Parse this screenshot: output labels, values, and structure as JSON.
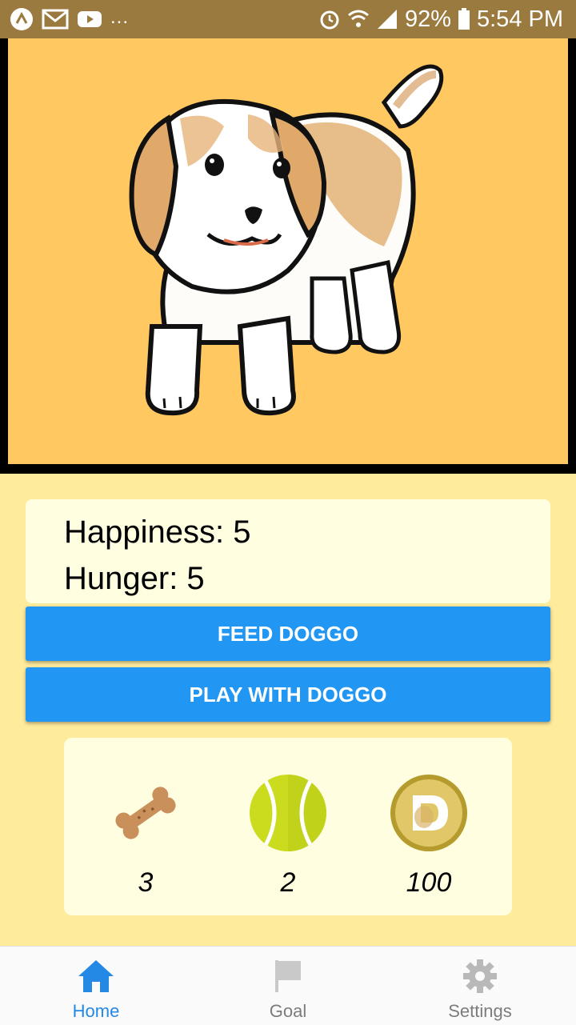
{
  "status_bar": {
    "overflow": "...",
    "battery": "92%",
    "time": "5:54 PM",
    "icons": [
      "app-icon",
      "gmail-icon",
      "youtube-icon",
      "alarm-icon",
      "wifi-icon",
      "signal-icon",
      "battery-icon"
    ]
  },
  "pet": {
    "image": "puppy-drawing"
  },
  "stats": {
    "happiness": "Happiness: 5",
    "hunger": "Hunger: 5"
  },
  "actions": {
    "feed_label": "FEED DOGGO",
    "play_label": "PLAY WITH DOGGO"
  },
  "inventory": {
    "items": [
      {
        "icon": "bone-icon",
        "count": "3"
      },
      {
        "icon": "tennis-ball-icon",
        "count": "2"
      },
      {
        "icon": "dogecoin-icon",
        "count": "100"
      }
    ]
  },
  "tabs": [
    {
      "label": "Home",
      "icon": "home-icon",
      "active": true
    },
    {
      "label": "Goal",
      "icon": "flag-icon",
      "active": false
    },
    {
      "label": "Settings",
      "icon": "gear-icon",
      "active": false
    }
  ],
  "colors": {
    "status_bar": "#9a7a3f",
    "image_background": "#ffc861",
    "app_background": "#ffeb9c",
    "card_background": "#fffee0",
    "button": "#2196f3",
    "active_tab": "#2488e5",
    "inactive_tab": "#7c7c7c"
  }
}
